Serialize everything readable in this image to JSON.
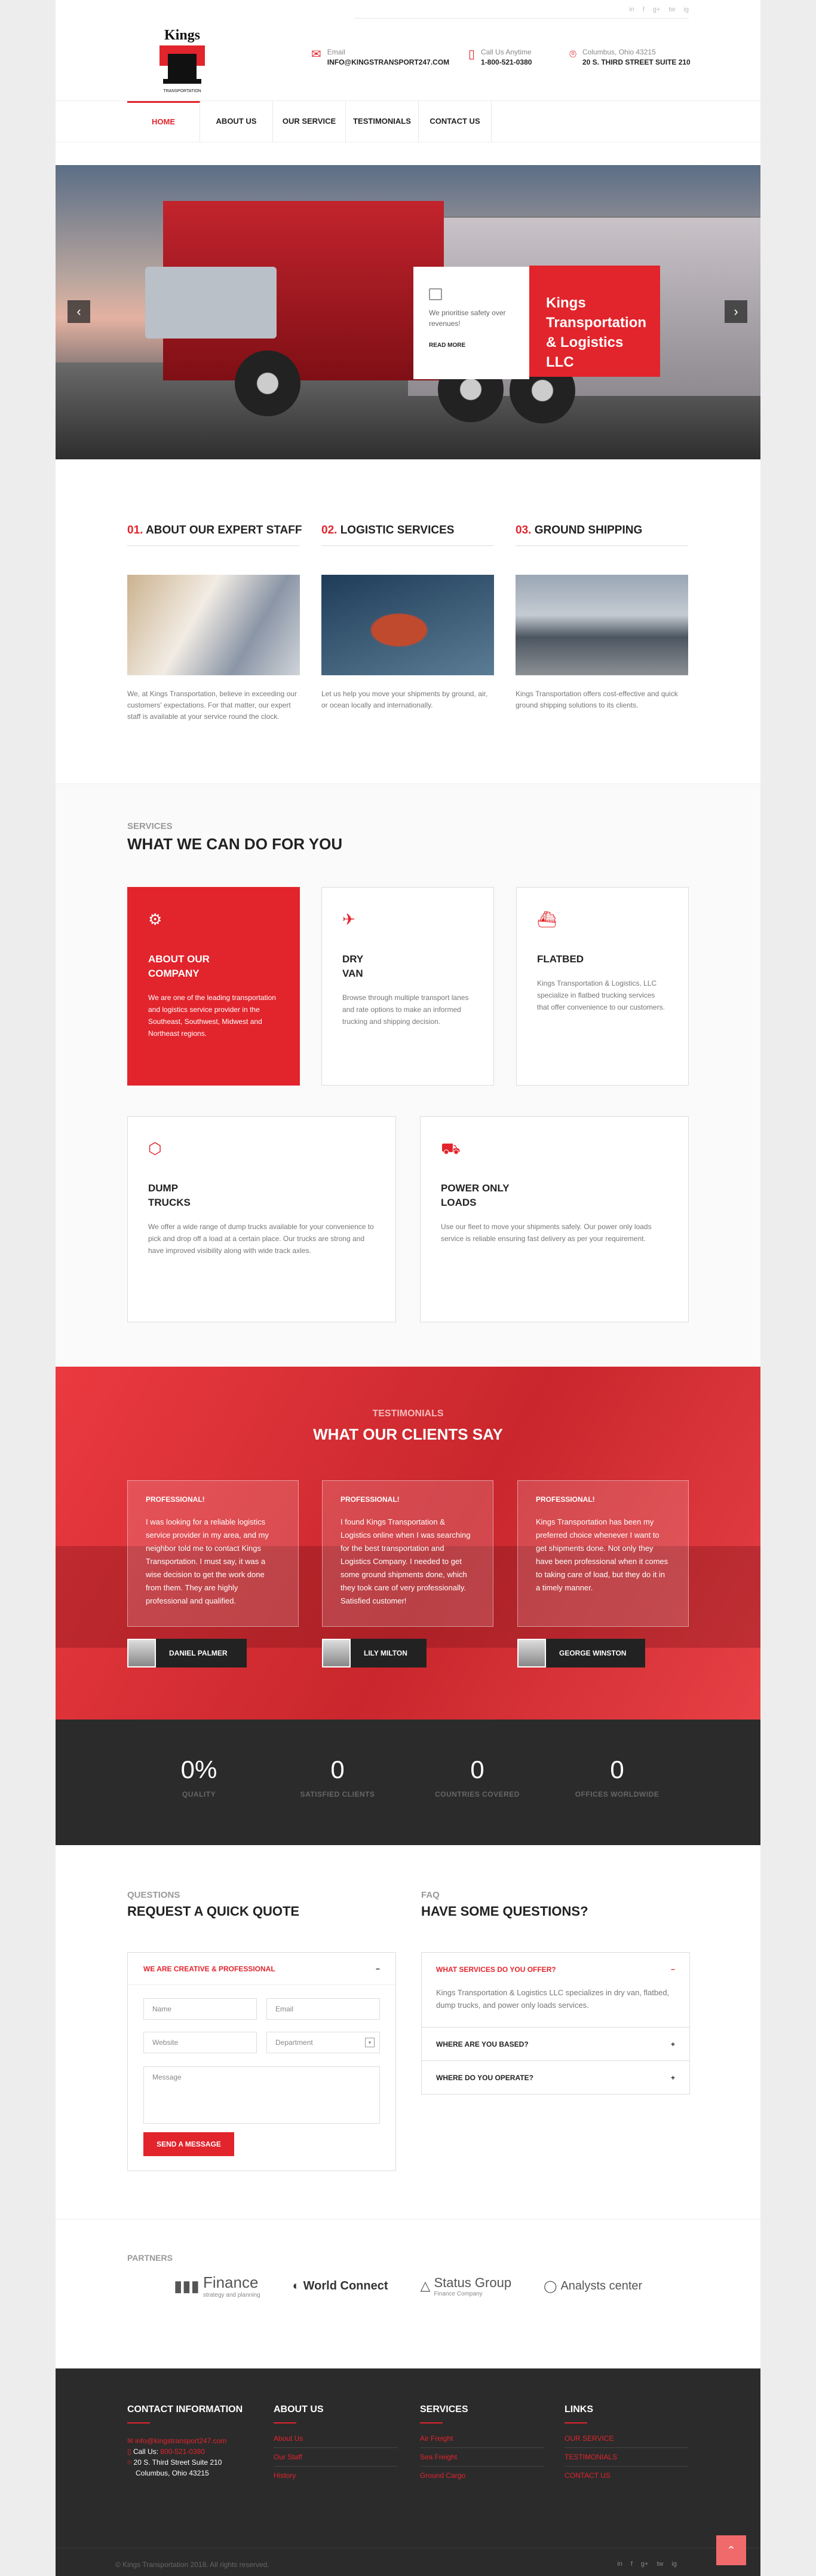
{
  "brand": {
    "name": "Kings",
    "sub": "TRANSPORTATION"
  },
  "social": [
    "in",
    "f",
    "g+",
    "tw",
    "ig"
  ],
  "contact": [
    {
      "icon": "mail-icon",
      "label": "Email",
      "value": "INFO@KINGSTRANSPORT247.COM"
    },
    {
      "icon": "phone-icon",
      "label": "Call Us Anytime",
      "value": "1-800-521-0380"
    },
    {
      "icon": "pin-icon",
      "label": "Columbus, Ohio 43215",
      "value": "20 S. THIRD STREET SUITE 210"
    }
  ],
  "nav": [
    "HOME",
    "ABOUT US",
    "OUR SERVICE",
    "TESTIMONIALS",
    "CONTACT US"
  ],
  "hero": {
    "card_text": "We prioritise safety over revenues!",
    "read_more": "READ MORE",
    "title": "Kings Transportation & Logistics LLC"
  },
  "about": [
    {
      "num": "01.",
      "title": "ABOUT OUR EXPERT STAFF",
      "text": "We, at Kings Transportation, believe in exceeding our customers' expectations. For that matter, our expert staff is available at your service round the clock."
    },
    {
      "num": "02.",
      "title": "LOGISTIC SERVICES",
      "text": "Let us help you move your shipments by ground, air, or ocean locally and internationally."
    },
    {
      "num": "03.",
      "title": "GROUND SHIPPING",
      "text": "Kings Transportation offers cost-effective and quick ground shipping solutions to its clients."
    }
  ],
  "services": {
    "eyebrow": "SERVICES",
    "heading": "WHAT WE CAN DO FOR YOU",
    "items": [
      {
        "title": "ABOUT OUR\nCOMPANY",
        "text": "We are one of the leading transportation and logistics service provider in the Southeast, Southwest, Midwest and Northeast regions."
      },
      {
        "title": "DRY\nVAN",
        "text": "Browse through multiple transport lanes and rate options to make an informed trucking and shipping decision."
      },
      {
        "title": "FLATBED",
        "text": "Kings Transportation & Logistics, LLC specialize in flatbed trucking services that offer convenience to our customers."
      },
      {
        "title": "DUMP\nTRUCKS",
        "text": "We offer a wide range of dump trucks available for your convenience to pick and drop off a load at a certain place. Our trucks are strong and have improved visibility along with wide track axles."
      },
      {
        "title": "POWER ONLY\nLOADS",
        "text": "Use our fleet to move your shipments safely. Our power only loads service is reliable ensuring fast delivery as per your requirement."
      }
    ]
  },
  "testimonials": {
    "eyebrow": "TESTIMONIALS",
    "heading": "WHAT OUR CLIENTS SAY",
    "items": [
      {
        "tag": "PROFESSIONAL!",
        "text": "I was looking for a reliable logistics service provider in my area, and my neighbor told me to contact Kings Transportation. I must say, it was a wise decision to get the work done from them. They are highly professional and qualified.",
        "name": "DANIEL PALMER"
      },
      {
        "tag": "PROFESSIONAL!",
        "text": "I found Kings Transportation & Logistics online when I was searching for the best transportation and Logistics Company. I needed to get some ground shipments done, which they took care of very professionally. Satisfied customer!",
        "name": "LILY MILTON"
      },
      {
        "tag": "PROFESSIONAL!",
        "text": "Kings Transportation has been my preferred choice whenever I want to get shipments done. Not only they have been professional when it comes to taking care of load, but they do it in a timely manner.",
        "name": "GEORGE WINSTON"
      }
    ]
  },
  "stats": [
    {
      "value": "0%",
      "label": "QUALITY"
    },
    {
      "value": "0",
      "label": "SATISFIED CLIENTS"
    },
    {
      "value": "0",
      "label": "COUNTRIES COVERED"
    },
    {
      "value": "0",
      "label": "OFFICES WORLDWIDE"
    }
  ],
  "quote": {
    "eyebrow": "QUESTIONS",
    "heading": "REQUEST A QUICK QUOTE",
    "bar": "WE ARE CREATIVE & PROFESSIONAL",
    "bar_icon": "−",
    "name": "Name",
    "email": "Email",
    "website": "Website",
    "department": "Department",
    "message": "Message",
    "button": "SEND A MESSAGE"
  },
  "faq": {
    "eyebrow": "FAQ",
    "heading": "HAVE SOME QUESTIONS?",
    "items": [
      {
        "q": "WHAT SERVICES DO YOU OFFER?",
        "icon": "−",
        "a": "Kings Transportation & Logistics LLC specializes in dry van, flatbed, dump trucks, and power only loads services."
      },
      {
        "q": "WHERE ARE YOU BASED?",
        "icon": "+"
      },
      {
        "q": "WHERE DO YOU OPERATE?",
        "icon": "+"
      }
    ]
  },
  "partners": {
    "title": "PARTNERS",
    "logos": [
      {
        "name": "Finance",
        "sub": "strategy and planning"
      },
      {
        "name": "World Connect",
        "sub": ""
      },
      {
        "name": "Status Group",
        "sub": "Finance Company"
      },
      {
        "name": "Analysts center",
        "sub": ""
      }
    ]
  },
  "footer": {
    "contact_title": "CONTACT INFORMATION",
    "email": "info@kingstransport247.com",
    "call_label": "Call Us:",
    "call": "800-521-0380",
    "addr1": "20 S. Third Street Suite 210",
    "addr2": "Columbus, Ohio 43215",
    "cols": [
      {
        "title": "ABOUT US",
        "links": [
          "About Us",
          "Our Staff",
          "History"
        ]
      },
      {
        "title": "SERVICES",
        "links": [
          "Air Freight",
          "Sea Freight",
          "Ground Cargo"
        ]
      },
      {
        "title": "LINKS",
        "links": [
          "OUR SERVICE",
          "TESTIMONIALS",
          "CONTACT US"
        ]
      }
    ],
    "copyright": "© Kings Transportation 2018. All rights reserved."
  },
  "colors": {
    "accent": "#e2242c",
    "dark": "#2b2b2b"
  }
}
